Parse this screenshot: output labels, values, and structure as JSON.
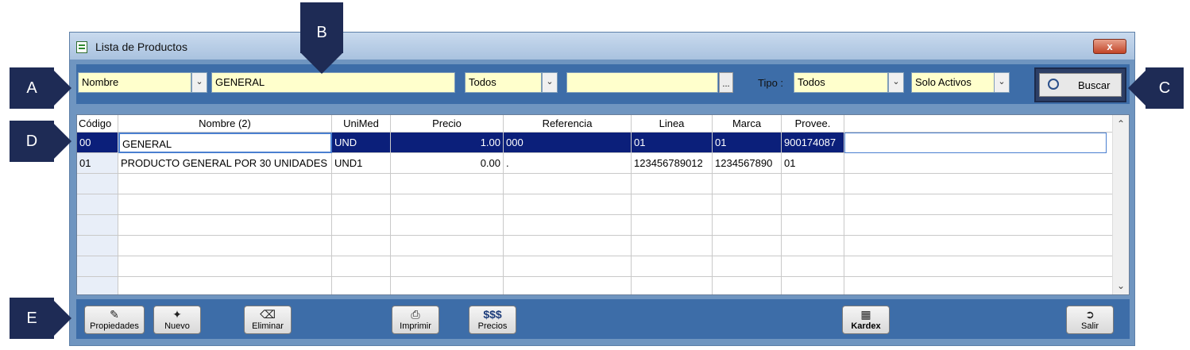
{
  "window": {
    "title": "Lista de Productos",
    "close_label": "x"
  },
  "filters": {
    "field_select": "Nombre",
    "search_text": "GENERAL",
    "group_select": "Todos",
    "group_value": "",
    "dots_label": "...",
    "tipo_label": "Tipo :",
    "tipo_select": "Todos",
    "status_select": "Solo Activos",
    "search_button": "Buscar"
  },
  "table": {
    "columns": [
      "Código",
      "Nombre (2)",
      "UniMed",
      "Precio",
      "Referencia",
      "Linea",
      "Marca",
      "Provee."
    ],
    "rows": [
      [
        "00",
        "GENERAL",
        "UND",
        "1.00",
        "000",
        "01",
        "01",
        "900174087"
      ],
      [
        "01",
        "PRODUCTO GENERAL POR 30 UNIDADES",
        "UND1",
        "0.00",
        ".",
        "123456789012",
        "1234567890",
        "01"
      ]
    ]
  },
  "toolbar": {
    "propiedades": "Propiedades",
    "nuevo": "Nuevo",
    "eliminar": "Eliminar",
    "imprimir": "Imprimir",
    "precios_icon": "$$$",
    "precios": "Precios",
    "kardex": "Kardex",
    "salir": "Salir"
  },
  "callouts": {
    "a": "A",
    "b": "B",
    "c": "C",
    "d": "D",
    "e": "E"
  },
  "colors": {
    "window_bg": "#6f95c0",
    "selection": "#0b1f7a",
    "field_bg": "#ffffcc",
    "callout": "#1e2b55"
  }
}
